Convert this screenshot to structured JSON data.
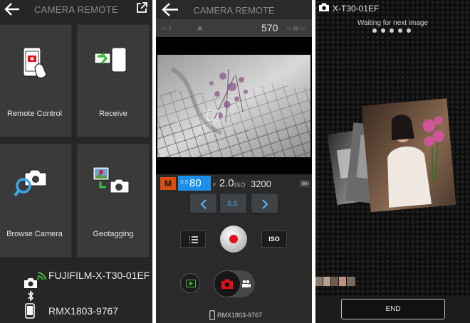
{
  "screens": {
    "menu": {
      "title": "CAMERA REMOTE",
      "tiles": [
        {
          "label": "Remote Control"
        },
        {
          "label": "Receive"
        },
        {
          "label": "Browse Camera"
        },
        {
          "label": "Geotagging"
        }
      ],
      "connection": {
        "camera_name": "FUJIFILM-X-T30-01EF",
        "phone_name": "RMX1803-9767"
      }
    },
    "remote": {
      "title": "CAMERA REMOTE",
      "shots_remaining": "570",
      "mode": "M",
      "shutter_label": "S.S.",
      "shutter_value": "80",
      "aperture_label": "F",
      "aperture_value": "2.0",
      "iso_label": "ISO",
      "iso_value": "3200",
      "ss_button_label": "S.S.",
      "iso_button_label": "ISO",
      "phone_name": "RMX1803-9767"
    },
    "receive": {
      "camera_name": "X-T30-01EF",
      "status": "Waiting for next image",
      "end_label": "END"
    }
  },
  "colors": {
    "accent_orange": "#d94f0f",
    "accent_blue": "#1e8fe8",
    "record_red": "#e0111b",
    "wifi_green": "#3fbf3f"
  }
}
